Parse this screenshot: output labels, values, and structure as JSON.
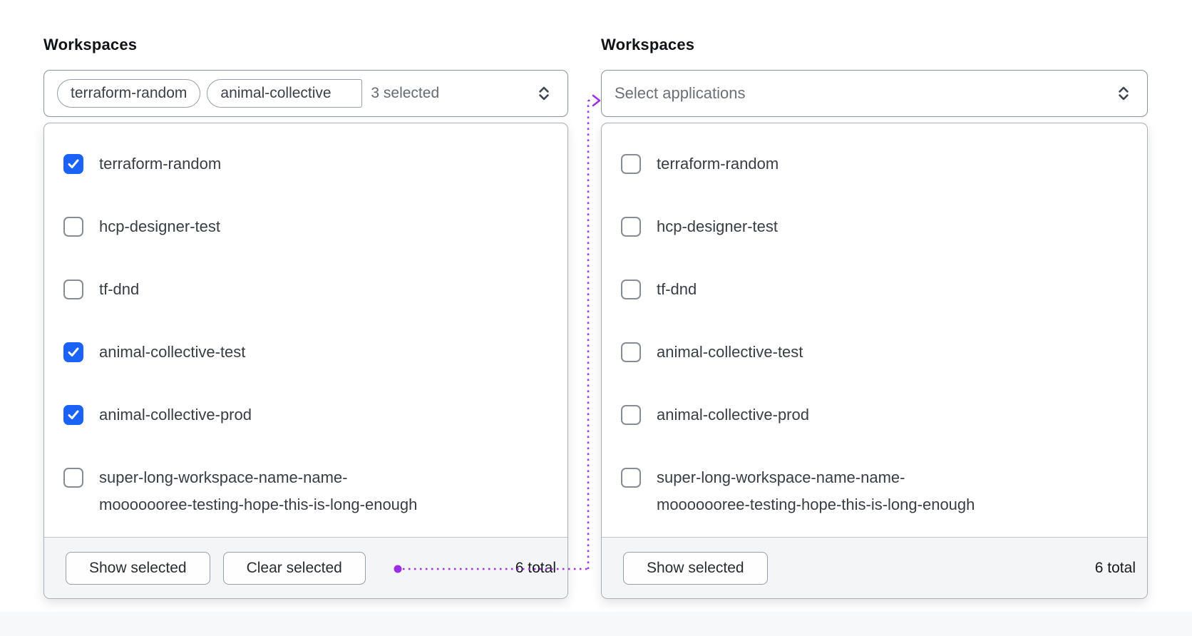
{
  "colors": {
    "checkbox_checked": "#1b62f8",
    "connector": "#9b2fe8"
  },
  "left_panel": {
    "label": "Workspaces",
    "trigger": {
      "tags": [
        "terraform-random",
        "animal-collective"
      ],
      "count_text": "3 selected",
      "chevron_icon": "unfold-chevrons"
    },
    "options": [
      {
        "label": "terraform-random",
        "checked": true
      },
      {
        "label": "hcp-designer-test",
        "checked": false
      },
      {
        "label": "tf-dnd",
        "checked": false
      },
      {
        "label": "animal-collective-test",
        "checked": true
      },
      {
        "label": "animal-collective-prod",
        "checked": true
      },
      {
        "label": "super-long-workspace-name-name-\nmooooooree-testing-hope-this-is-long-enough",
        "checked": false
      }
    ],
    "footer": {
      "show_selected": "Show selected",
      "clear_selected": "Clear selected",
      "total": "6 total"
    }
  },
  "right_panel": {
    "label": "Workspaces",
    "trigger": {
      "placeholder": "Select applications",
      "chevron_icon": "unfold-chevrons"
    },
    "options": [
      {
        "label": "terraform-random",
        "checked": false
      },
      {
        "label": "hcp-designer-test",
        "checked": false
      },
      {
        "label": "tf-dnd",
        "checked": false
      },
      {
        "label": "animal-collective-test",
        "checked": false
      },
      {
        "label": "animal-collective-prod",
        "checked": false
      },
      {
        "label": "super-long-workspace-name-name-\nmooooooree-testing-hope-this-is-long-enough",
        "checked": false
      }
    ],
    "footer": {
      "show_selected": "Show selected",
      "total": "6 total"
    }
  }
}
